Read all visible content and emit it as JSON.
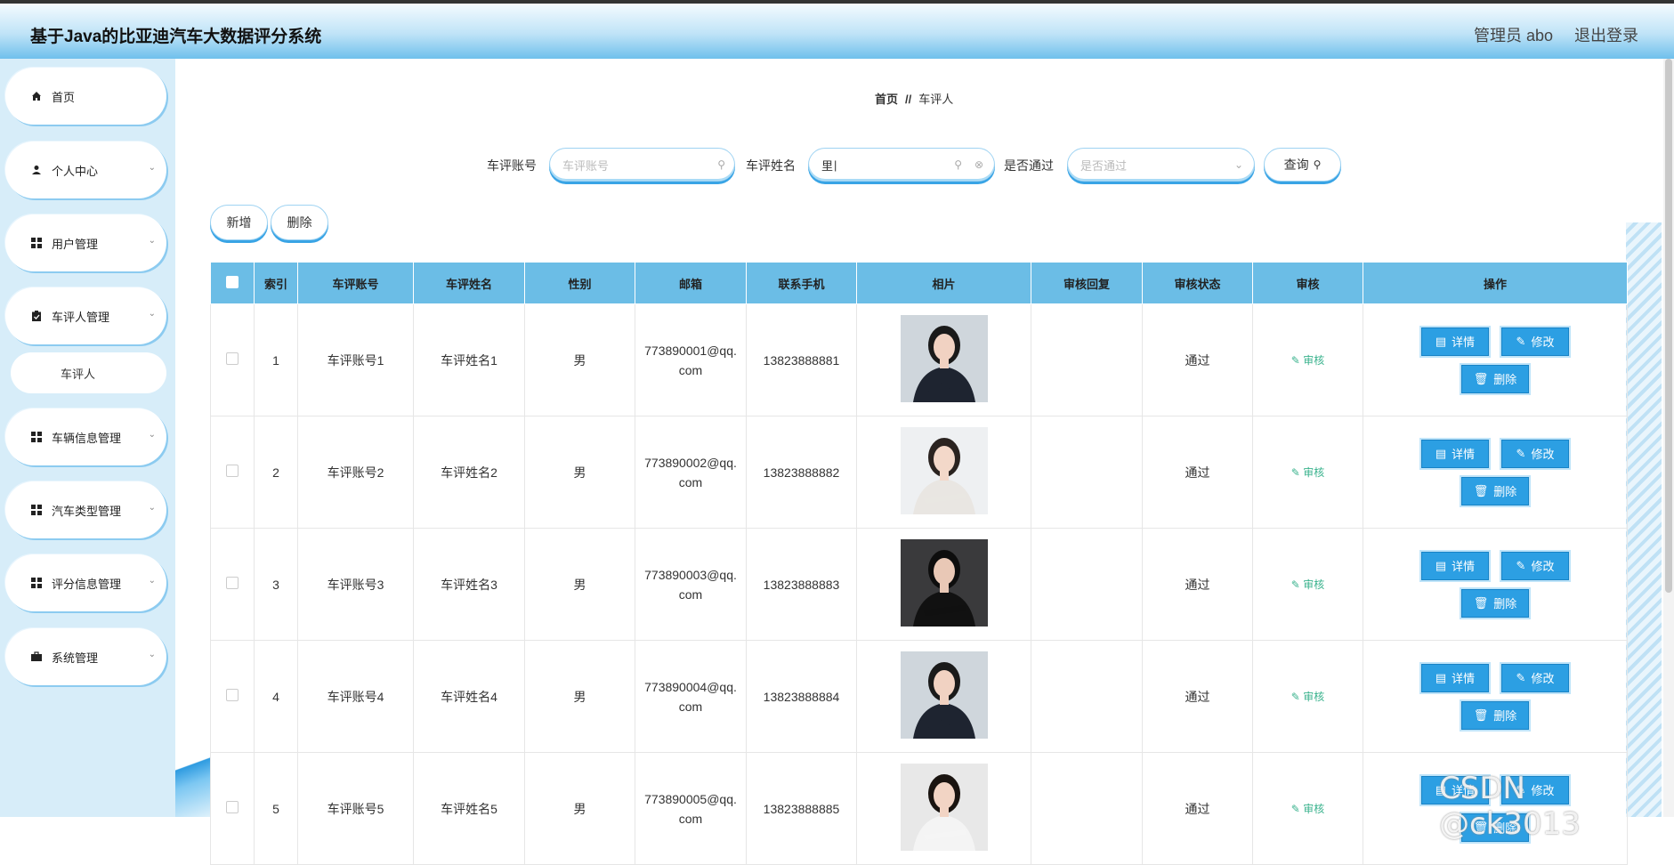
{
  "header": {
    "title": "基于Java的比亚迪汽车大数据评分系统",
    "user_label": "管理员 abo",
    "logout_label": "退出登录"
  },
  "sidebar": {
    "items": [
      {
        "label": "首页",
        "icon": "home-icon"
      },
      {
        "label": "个人中心",
        "icon": "person-icon"
      },
      {
        "label": "用户管理",
        "icon": "grid-icon"
      },
      {
        "label": "车评人管理",
        "icon": "clipboard-icon"
      },
      {
        "label": "车辆信息管理",
        "icon": "grid-icon"
      },
      {
        "label": "汽车类型管理",
        "icon": "grid-icon"
      },
      {
        "label": "评分信息管理",
        "icon": "grid-icon"
      },
      {
        "label": "系统管理",
        "icon": "briefcase-icon"
      }
    ],
    "sub_item": "车评人"
  },
  "breadcrumb": {
    "home": "首页",
    "sep": "//",
    "current": "车评人"
  },
  "search": {
    "account_label": "车评账号",
    "account_placeholder": "车评账号",
    "name_label": "车评姓名",
    "name_value": "里",
    "pass_label": "是否通过",
    "pass_placeholder": "是否通过",
    "query_label": "查询"
  },
  "actions": {
    "add_label": "新增",
    "delete_label": "删除"
  },
  "table": {
    "columns": [
      "索引",
      "车评账号",
      "车评姓名",
      "性别",
      "邮箱",
      "联系手机",
      "相片",
      "审核回复",
      "审核状态",
      "审核",
      "操作"
    ],
    "rows": [
      {
        "index": "1",
        "account": "车评账号1",
        "name": "车评姓名1",
        "gender": "男",
        "email": "773890001@qq.com",
        "phone": "13823888881",
        "reply": "",
        "status": "通过",
        "photo": "dark"
      },
      {
        "index": "2",
        "account": "车评账号2",
        "name": "车评姓名2",
        "gender": "男",
        "email": "773890002@qq.com",
        "phone": "13823888882",
        "reply": "",
        "status": "通过",
        "photo": "light"
      },
      {
        "index": "3",
        "account": "车评账号3",
        "name": "车评姓名3",
        "gender": "男",
        "email": "773890003@qq.com",
        "phone": "13823888883",
        "reply": "",
        "status": "通过",
        "photo": "black"
      },
      {
        "index": "4",
        "account": "车评账号4",
        "name": "车评姓名4",
        "gender": "男",
        "email": "773890004@qq.com",
        "phone": "13823888884",
        "reply": "",
        "status": "通过",
        "photo": "dark"
      },
      {
        "index": "5",
        "account": "车评账号5",
        "name": "车评姓名5",
        "gender": "男",
        "email": "773890005@qq.com",
        "phone": "13823888885",
        "reply": "",
        "status": "通过",
        "photo": "white"
      }
    ],
    "audit_label": "审核",
    "detail_label": "详情",
    "edit_label": "修改",
    "delete_label": "删除"
  },
  "watermark": "CSDN @ck3013",
  "colors": {
    "accent": "#2c9fe3",
    "header_bg": "#6bbde6",
    "audit": "#3bb38e"
  }
}
